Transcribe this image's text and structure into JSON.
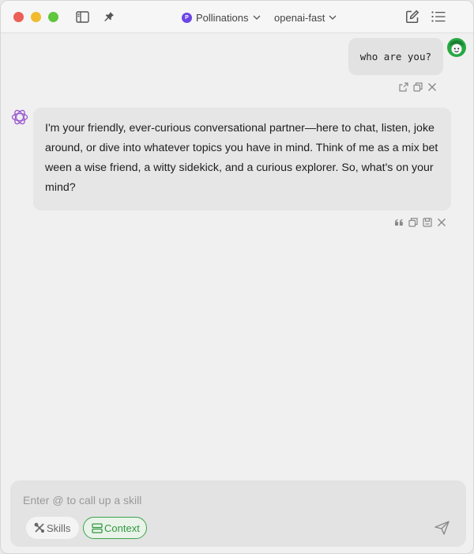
{
  "titlebar": {
    "provider_label": "Pollinations",
    "provider_badge": "P",
    "model_label": "openai-fast"
  },
  "chat": {
    "user_message": "who are you?",
    "assistant_message": "I'm your friendly, ever-curious conversational partner—here to chat, listen, joke around, or dive into whatever topics you have in mind. Think of me as a mix between a wise friend, a witty sidekick, and a curious explorer. So, what's on your mind?"
  },
  "composer": {
    "placeholder": "Enter @ to call up a skill",
    "skills_label": "Skills",
    "context_label": "Context"
  },
  "colors": {
    "accent_green": "#3aa34a",
    "provider_purple": "#6b46e6",
    "assistant_logo": "#9b59d0"
  },
  "icons": {
    "sidebar": "sidebar-toggle-icon",
    "pin": "pin-icon",
    "edit": "new-chat-edit-icon",
    "list": "list-icon",
    "share": "share-icon",
    "copy": "copy-icon",
    "delete": "close-icon",
    "quote": "quote-icon",
    "save": "save-icon",
    "send": "send-icon"
  }
}
